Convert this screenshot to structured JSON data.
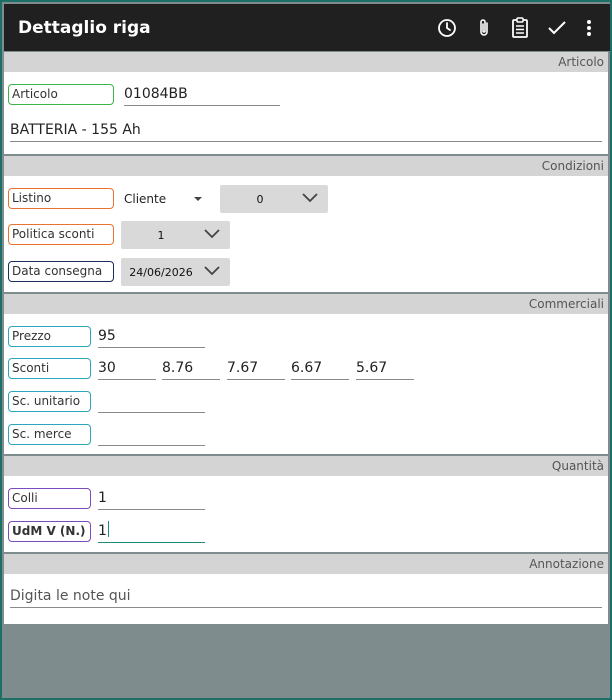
{
  "appbar": {
    "title": "Dettaglio riga",
    "icons": [
      "history-icon",
      "attach-icon",
      "clipboard-icon",
      "check-icon",
      "more-vertical-icon"
    ]
  },
  "sections": {
    "articolo": "Articolo",
    "condizioni": "Condizioni",
    "commerciali": "Commerciali",
    "quantita": "Quantità",
    "annotazione": "Annotazione"
  },
  "articolo": {
    "label": "Articolo",
    "code": "01084BB",
    "description": "BATTERIA - 155 Ah"
  },
  "condizioni": {
    "listino_label": "Listino",
    "listino_type": "Cliente",
    "listino_value": "0",
    "politica_label": "Politica sconti",
    "politica_value": "1",
    "data_label": "Data consegna",
    "data_value": "24/06/2026"
  },
  "commerciali": {
    "prezzo_label": "Prezzo",
    "prezzo_value": "95",
    "sconti_label": "Sconti",
    "sconti_values": [
      "30",
      "8.76",
      "7.67",
      "6.67",
      "5.67"
    ],
    "sc_unitario_label": "Sc. unitario",
    "sc_unitario_value": "",
    "sc_merce_label": "Sc. merce",
    "sc_merce_value": ""
  },
  "quantita": {
    "colli_label": "Colli",
    "colli_value": "1",
    "udm_label": "UdM V (N.)",
    "udm_value": "1"
  },
  "annotazione": {
    "placeholder": "Digita le note qui"
  },
  "colors": {
    "appbar": "#202020",
    "accent": "#1e8a7e",
    "green": "#3ab54a",
    "orange": "#e8732f",
    "navy": "#1f2d5a",
    "teal": "#2ba6bd",
    "purple": "#7a4bbd"
  }
}
